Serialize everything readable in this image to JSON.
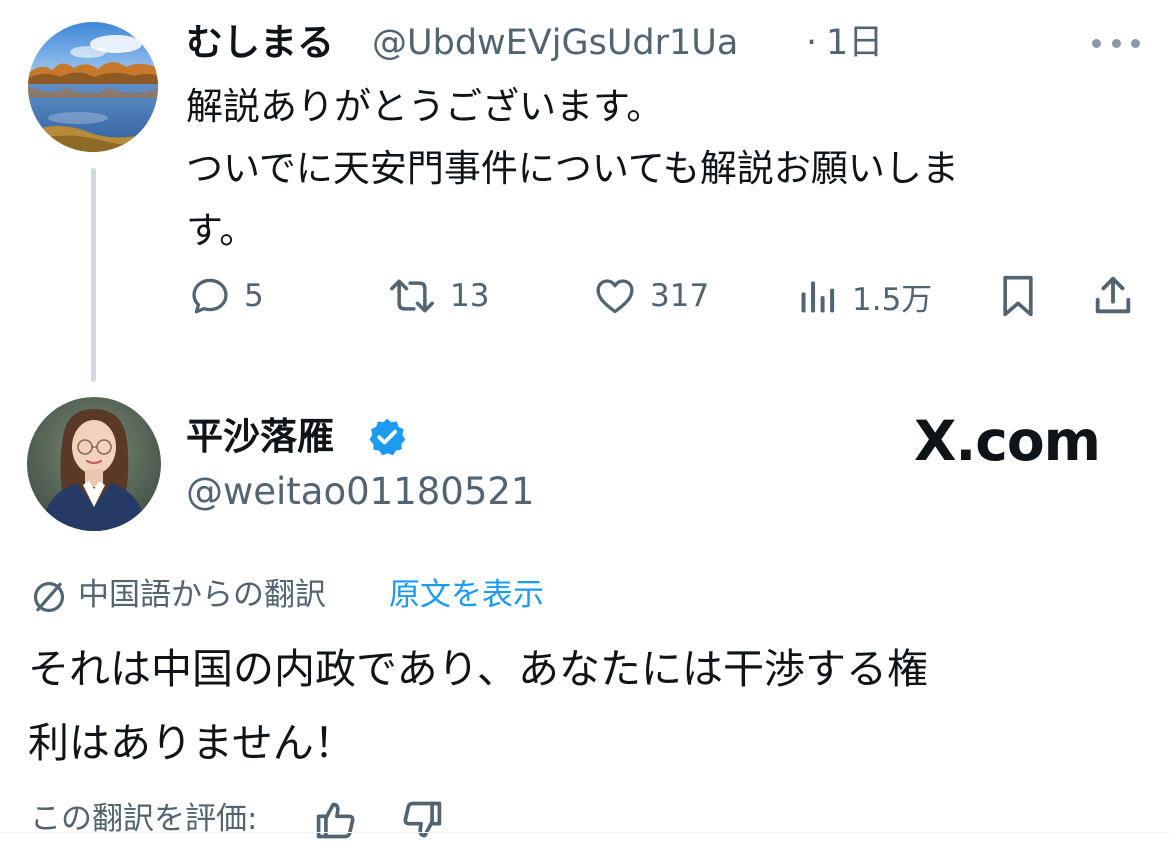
{
  "reply": {
    "display_name": "むしまる",
    "handle": "@UbdwEVjGsUdr1Ua",
    "separator": "·",
    "time": "1日",
    "text_lines": [
      "解説ありがとうございます。",
      "ついでに天安門事件についても解説お願いしま",
      "す。"
    ],
    "actions": {
      "replies": "5",
      "reposts": "13",
      "likes": "317",
      "views": "1.5万"
    }
  },
  "main_post": {
    "display_name": "平沙落雁",
    "handle": "@weitao01180521",
    "verified": true,
    "verified_color": "#1d9bf0",
    "site_label": "X.com",
    "translation": {
      "label": "中国語からの翻訳",
      "show_original": "原文を表示",
      "rate_label": "この翻訳を評価:"
    },
    "text_lines": [
      "それは中国の内政であり、あなたには干渉する権",
      "利はありません！"
    ]
  },
  "icons": {
    "more": "more-icon",
    "reply": "reply-icon",
    "repost": "repost-icon",
    "like": "heart-icon",
    "views": "views-icon",
    "bookmark": "bookmark-icon",
    "share": "share-icon",
    "translate": "translate-icon",
    "thumb_up": "thumb-up-icon",
    "thumb_down": "thumb-down-icon",
    "verified": "verified-badge-icon"
  },
  "colors": {
    "text": "#0f1419",
    "secondary": "#536471",
    "link": "#1d9bf0",
    "thread_line": "#cfd9de"
  }
}
